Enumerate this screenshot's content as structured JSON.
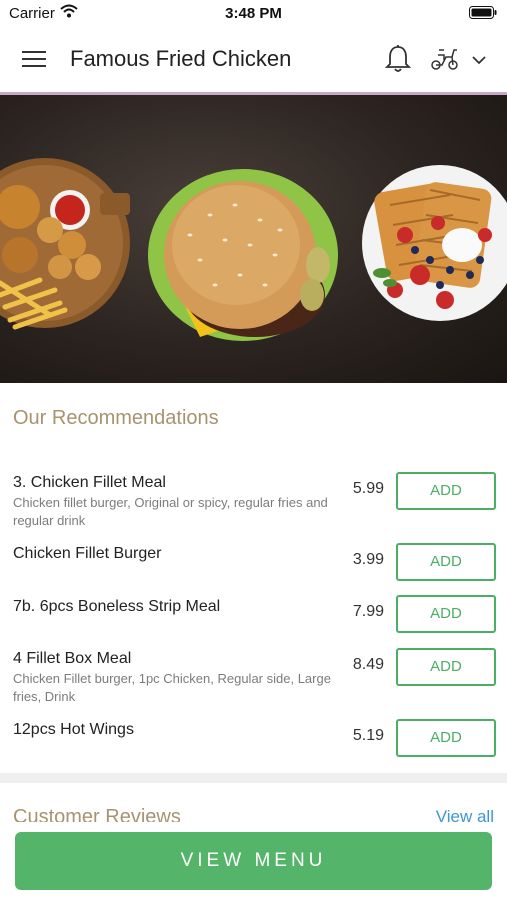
{
  "status_bar": {
    "carrier": "Carrier",
    "time": "3:48 PM"
  },
  "header": {
    "title": "Famous Fried Chicken",
    "icons": [
      "hamburger-menu-icon",
      "bell-icon",
      "scooter-icon",
      "chevron-down-icon"
    ]
  },
  "hero": {
    "content": [
      "chicken-platter",
      "burger",
      "waffles"
    ]
  },
  "recommendations": {
    "title": "Our Recommendations",
    "add_label": "ADD",
    "items": [
      {
        "name": "3. Chicken Fillet Meal",
        "desc": "Chicken fillet burger, Original or spicy, regular fries and regular drink",
        "price": "5.99"
      },
      {
        "name": "Chicken Fillet Burger",
        "desc": "",
        "price": "3.99"
      },
      {
        "name": "7b. 6pcs Boneless Strip Meal",
        "desc": "",
        "price": "7.99"
      },
      {
        "name": "4 Fillet Box Meal",
        "desc": "Chicken Fillet burger, 1pc Chicken, Regular side, Large fries, Drink",
        "price": "8.49"
      },
      {
        "name": "12pcs Hot Wings",
        "desc": "",
        "price": "5.19"
      }
    ]
  },
  "reviews": {
    "title": "Customer Reviews",
    "view_all": "View all"
  },
  "footer": {
    "view_menu": "VIEW MENU"
  },
  "colors": {
    "accent_green": "#54b46a",
    "section_title": "#a79370",
    "link_blue": "#3d98d0",
    "header_border": "#c9a7c6"
  }
}
